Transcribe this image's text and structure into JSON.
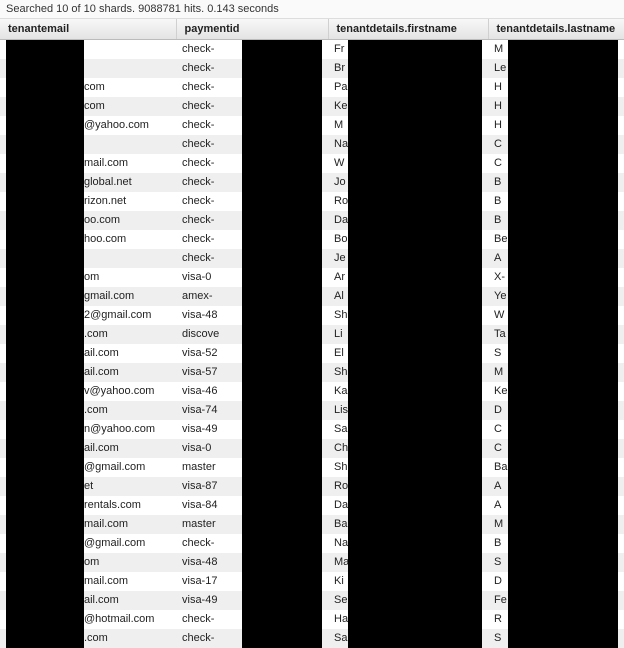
{
  "status": "Searched 10 of 10 shards. 9088781 hits. 0.143 seconds",
  "columns": {
    "email": "tenantemail",
    "payment": "paymentid",
    "first": "tenantdetails.firstname",
    "last": "tenantdetails.lastname"
  },
  "rows": [
    {
      "email_suffix": "",
      "payment_prefix": "check-",
      "first_prefix": "Fr",
      "last_prefix": "M"
    },
    {
      "email_suffix": "",
      "payment_prefix": "check-",
      "first_prefix": "Br",
      "last_prefix": "Le"
    },
    {
      "email_suffix": "com",
      "payment_prefix": "check-",
      "first_prefix": "Pa",
      "last_prefix": "H"
    },
    {
      "email_suffix": "com",
      "payment_prefix": "check-",
      "first_prefix": "Ke",
      "last_prefix": "H"
    },
    {
      "email_suffix": "@yahoo.com",
      "payment_prefix": "check-",
      "first_prefix": "M",
      "last_prefix": "H"
    },
    {
      "email_suffix": "",
      "payment_prefix": "check-",
      "first_prefix": "Na",
      "last_prefix": "C"
    },
    {
      "email_suffix": "mail.com",
      "payment_prefix": "check-",
      "first_prefix": "W",
      "last_prefix": "C"
    },
    {
      "email_suffix": "global.net",
      "payment_prefix": "check-",
      "first_prefix": "Jo",
      "last_prefix": "B"
    },
    {
      "email_suffix": "rizon.net",
      "payment_prefix": "check-",
      "first_prefix": "Ro",
      "last_prefix": "B"
    },
    {
      "email_suffix": "oo.com",
      "payment_prefix": "check-",
      "first_prefix": "Da",
      "last_prefix": "B"
    },
    {
      "email_suffix": "hoo.com",
      "payment_prefix": "check-",
      "first_prefix": "Bo",
      "last_prefix": "Be"
    },
    {
      "email_suffix": "",
      "payment_prefix": "check-",
      "first_prefix": "Je",
      "last_prefix": "A"
    },
    {
      "email_suffix": "om",
      "payment_prefix": "visa-0",
      "first_prefix": "Ar",
      "last_prefix": "X-"
    },
    {
      "email_suffix": "gmail.com",
      "payment_prefix": "amex-",
      "first_prefix": "Al",
      "last_prefix": "Ye"
    },
    {
      "email_suffix": "2@gmail.com",
      "payment_prefix": "visa-48",
      "first_prefix": "Sh",
      "last_prefix": "W"
    },
    {
      "email_suffix": ".com",
      "payment_prefix": "discove",
      "first_prefix": "Li",
      "last_prefix": "Ta"
    },
    {
      "email_suffix": "ail.com",
      "payment_prefix": "visa-52",
      "first_prefix": "El",
      "last_prefix": "S"
    },
    {
      "email_suffix": "ail.com",
      "payment_prefix": "visa-57",
      "first_prefix": "Sh",
      "last_prefix": "M"
    },
    {
      "email_suffix": "v@yahoo.com",
      "payment_prefix": "visa-46",
      "first_prefix": "Ka",
      "last_prefix": "Ke"
    },
    {
      "email_suffix": ".com",
      "payment_prefix": "visa-74",
      "first_prefix": "Lis",
      "last_prefix": "D"
    },
    {
      "email_suffix": "n@yahoo.com",
      "payment_prefix": "visa-49",
      "first_prefix": "Sa",
      "last_prefix": "C"
    },
    {
      "email_suffix": "ail.com",
      "payment_prefix": "visa-0",
      "first_prefix": "Ch",
      "last_prefix": "C"
    },
    {
      "email_suffix": "@gmail.com",
      "payment_prefix": "master",
      "first_prefix": "Sh",
      "last_prefix": "Ba"
    },
    {
      "email_suffix": "et",
      "payment_prefix": "visa-87",
      "first_prefix": "Ro",
      "last_prefix": "A"
    },
    {
      "email_suffix": "rentals.com",
      "payment_prefix": "visa-84",
      "first_prefix": "Da",
      "last_prefix": "A"
    },
    {
      "email_suffix": "mail.com",
      "payment_prefix": "master",
      "first_prefix": "Ba",
      "last_prefix": "M"
    },
    {
      "email_suffix": "@gmail.com",
      "payment_prefix": "check-",
      "first_prefix": "Na",
      "last_prefix": "B"
    },
    {
      "email_suffix": "om",
      "payment_prefix": "visa-48",
      "first_prefix": "Ma",
      "last_prefix": "S"
    },
    {
      "email_suffix": "mail.com",
      "payment_prefix": "visa-17",
      "first_prefix": "Ki",
      "last_prefix": "D"
    },
    {
      "email_suffix": "ail.com",
      "payment_prefix": "visa-49",
      "first_prefix": "Se",
      "last_prefix": "Fe"
    },
    {
      "email_suffix": "@hotmail.com",
      "payment_prefix": "check-",
      "first_prefix": "Ha",
      "last_prefix": "R"
    },
    {
      "email_suffix": ".com",
      "payment_prefix": "check-",
      "first_prefix": "Sa",
      "last_prefix": "S"
    }
  ]
}
